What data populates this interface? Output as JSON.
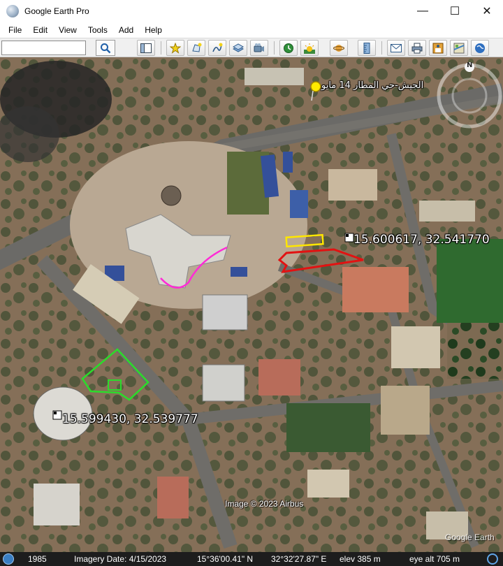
{
  "window": {
    "title": "Google Earth Pro",
    "controls": {
      "minimize": "—",
      "maximize": "☐",
      "close": "✕"
    }
  },
  "menu": [
    "File",
    "Edit",
    "View",
    "Tools",
    "Add",
    "Help"
  ],
  "toolbar": {
    "search_value": "",
    "buttons": [
      "sidebar-icon",
      "add-placemark-icon",
      "add-polygon-icon",
      "add-path-icon",
      "add-image-overlay-icon",
      "record-tour-icon",
      "historical-imagery-icon",
      "sunlight-icon",
      "planets-icon",
      "ruler-icon",
      "email-icon",
      "print-icon",
      "save-image-icon",
      "view-in-maps-icon",
      "earth-gallery-icon"
    ]
  },
  "map": {
    "placemark_label": "الجيش-حي المطار 14 مايو",
    "coord_label_1": "15.600617, 32.541770",
    "coord_label_2": "15.599430, 32.539777",
    "compass_letter": "N",
    "attribution": "Image © 2023 Airbus",
    "brand": "Google Earth",
    "overlay_colors": {
      "magenta": "#ff2bd6",
      "red": "#e21212",
      "yellow": "#ffe600",
      "green": "#2bdc2b"
    }
  },
  "status": {
    "year": "1985",
    "imagery_date": "Imagery Date: 4/15/2023",
    "latitude": "15°36'00.41\" N",
    "longitude": "32°32'27.87\" E",
    "elevation": "elev   385 m",
    "eye_alt": "eye alt   705 m"
  }
}
